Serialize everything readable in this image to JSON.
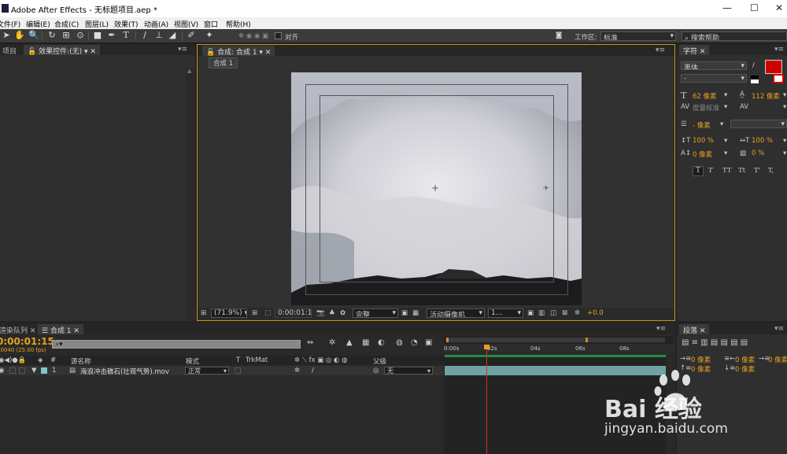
{
  "window": {
    "title": "Adobe After Effects - 无标题项目.aep *",
    "controls": [
      "—",
      "☐",
      "✕"
    ]
  },
  "menu": [
    "文件(F)",
    "编辑(E)",
    "合成(C)",
    "图层(L)",
    "效果(T)",
    "动画(A)",
    "视图(V)",
    "窗口",
    "帮助(H)"
  ],
  "toolbar": {
    "align_label": "对齐",
    "workspace_label": "工作区:",
    "workspace_value": "标准",
    "search_placeholder": "搜索帮助"
  },
  "project_panel": {
    "tab_project": "项目",
    "tab_effects": "效果控件:(无)"
  },
  "comp_panel": {
    "tab_label": "合成: 合成 1",
    "breadcrumb": "合成 1",
    "zoom": "(71.9%)",
    "timecode": "0:00:01:15",
    "resolution": "完整",
    "camera": "活动摄像机",
    "views": "1...",
    "exposure": "+0.0"
  },
  "character_panel": {
    "tab": "字符",
    "font_family": "黑体",
    "font_style": "-",
    "font_size": "62 像素",
    "leading": "112 像素",
    "kerning": "度量标准",
    "tracking": "",
    "stroke_width": "- 像素",
    "vscale": "100 %",
    "hscale": "100 %",
    "baseline": "0 像素",
    "tsume": "0 %",
    "styles": [
      "T",
      "T",
      "TT",
      "Tt",
      "T'",
      "T,"
    ],
    "fill_color": "#d00000"
  },
  "paragraph_panel": {
    "tab": "段落",
    "indent_left": "0 像素",
    "indent_right": "0 像素",
    "indent_first": "0 像素",
    "space_before": "0 像素",
    "space_after": "0 像素"
  },
  "timeline": {
    "tab_render": "渲染队列",
    "tab_comp": "合成 1",
    "timecode": "0:00:01:15",
    "fps": "00040 (25.00 fps)",
    "search_placeholder": "⌕▾",
    "col_name": "源名称",
    "col_mode": "模式",
    "col_t": "T",
    "col_trkmat": "TrkMat",
    "col_parent": "父级",
    "layer": {
      "index": "1",
      "name": "海浪冲击礁石(壮观气势).mov",
      "mode": "正常",
      "parent": "无"
    },
    "ruler": [
      "0:00s",
      "02s",
      "04s",
      "06s",
      "08s"
    ],
    "playhead_fraction": 0.19
  },
  "watermark": {
    "brand": "Bai 经验",
    "url": "jingyan.baidu.com"
  }
}
